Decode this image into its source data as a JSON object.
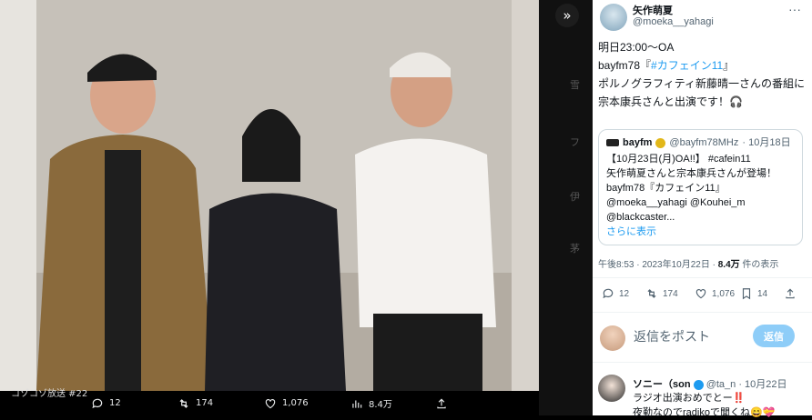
{
  "media": {
    "caption_overlay": "コゾコゾ放送 #22",
    "actions": {
      "reply_count": "12",
      "retweet_count": "174",
      "like_count": "1,076",
      "views_count": "8.4万"
    }
  },
  "sidebar_fragments": [
    "雪",
    "フ",
    "伊",
    "茅"
  ],
  "tweet": {
    "author_name": "矢作萌夏",
    "author_handle": "@moeka__yahagi",
    "text_line1": "明日23:00〜OA",
    "text_line2_prefix": "bayfm78『",
    "text_hashtag": "#カフェイン11",
    "text_line2_suffix": "』",
    "text_rest": "ポルノグラフィティ新藤晴一さんの番組に\n宗本康兵さんと出演です！🎧",
    "quote": {
      "author_name": "bayfm",
      "author_handle": "@bayfm78MHz",
      "date": "· 10月18日",
      "body": "【10月23日(月)OA!!】 #cafein11\n矢作萌夏さんと宗本康兵さんが登場！\nbayfm78『カフェイン11』\n@moeka__yahagi @Kouhei_m\n@blackcaster...",
      "show_more": "さらに表示"
    },
    "timestamp": "午後8:53 · 2023年10月22日 · ",
    "views_value": "8.4万",
    "views_label": " 件の表示",
    "stats": {
      "replies": "12",
      "retweets": "174",
      "likes": "1,076",
      "bookmarks": "14"
    }
  },
  "reply_box": {
    "placeholder": "返信をポスト",
    "button": "返信"
  },
  "reply": {
    "author_name": "ソニー（son",
    "author_handle": "@ta_n",
    "date": "· 10月22日",
    "text": "ラジオ出演おめでとー‼️\n夜勤なのでradikoで聞くね😄💝"
  },
  "colors": {
    "accent": "#1d9bf0",
    "reply_button": "#8ecdf8",
    "muted": "#536471"
  }
}
